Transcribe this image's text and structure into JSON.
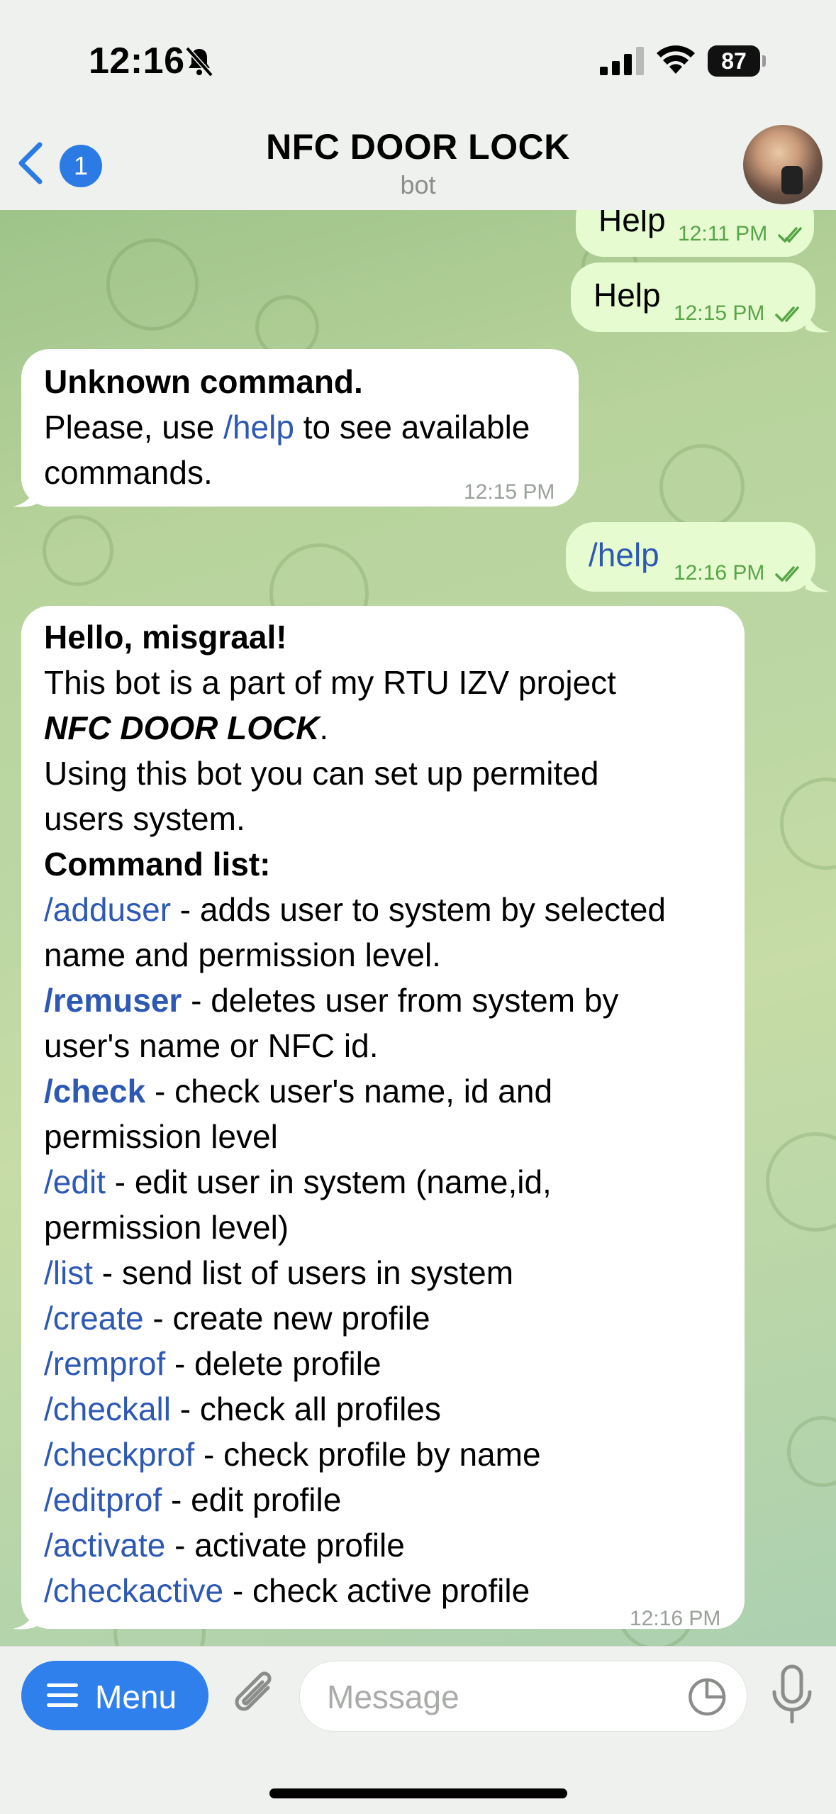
{
  "status_bar": {
    "time": "12:16",
    "battery": "87"
  },
  "header": {
    "back_badge": "1",
    "title": "NFC DOOR LOCK",
    "subtitle": "bot"
  },
  "messages": {
    "m1": {
      "text": "Help",
      "time": "12:11 PM"
    },
    "m2": {
      "text": "Help",
      "time": "12:15 PM"
    },
    "m3": {
      "line1": "Unknown command.",
      "line2_pre": "Please, use ",
      "line2_cmd": "/help",
      "line2_post": " to see available",
      "line3": "commands.",
      "time": "12:15 PM"
    },
    "m4": {
      "text": "/help",
      "time": "12:16 PM"
    },
    "m5": {
      "greeting": "Hello, misgraal!",
      "intro1": "This bot is a part of my RTU IZV project",
      "project": "NFC DOOR LOCK",
      "period": ".",
      "intro2a": "Using this bot you can set up permited",
      "intro2b": "users system.",
      "cmd_header": "Command list:",
      "commands": [
        {
          "cmd": "/adduser",
          "desc": " - adds user to system by selected",
          "desc2": "name and permission level."
        },
        {
          "cmd": "/remuser",
          "desc": " - deletes user from system by",
          "desc2": "user's name or NFC id."
        },
        {
          "cmd": "/check",
          "desc": " - check user's name, id and",
          "desc2": "permission level"
        },
        {
          "cmd": "/edit",
          "desc": " - edit user in system (name,id,",
          "desc2": "permission level)"
        },
        {
          "cmd": "/list",
          "desc": " - send list of users in system"
        },
        {
          "cmd": "/create",
          "desc": " - create new profile"
        },
        {
          "cmd": "/remprof",
          "desc": " - delete profile"
        },
        {
          "cmd": "/checkall",
          "desc": " - check all profiles"
        },
        {
          "cmd": "/checkprof",
          "desc": " - check profile by name"
        },
        {
          "cmd": "/editprof",
          "desc": " - edit profile"
        },
        {
          "cmd": "/activate",
          "desc": " - activate profile"
        },
        {
          "cmd": "/checkactive",
          "desc": " - check active profile"
        }
      ],
      "time": "12:16 PM"
    }
  },
  "composer": {
    "menu_label": "Menu",
    "placeholder": "Message"
  },
  "colors": {
    "accent": "#2f80ed",
    "link": "#2d58b3",
    "outgoing_bubble": "#e6fbd0",
    "outgoing_time": "#58a548"
  },
  "icons": [
    "bell-slash-icon",
    "cellular-signal-icon",
    "wifi-icon",
    "battery-icon",
    "chevron-left-icon",
    "paperclip-icon",
    "sticker-icon",
    "microphone-icon",
    "double-check-icon",
    "hamburger-icon"
  ]
}
